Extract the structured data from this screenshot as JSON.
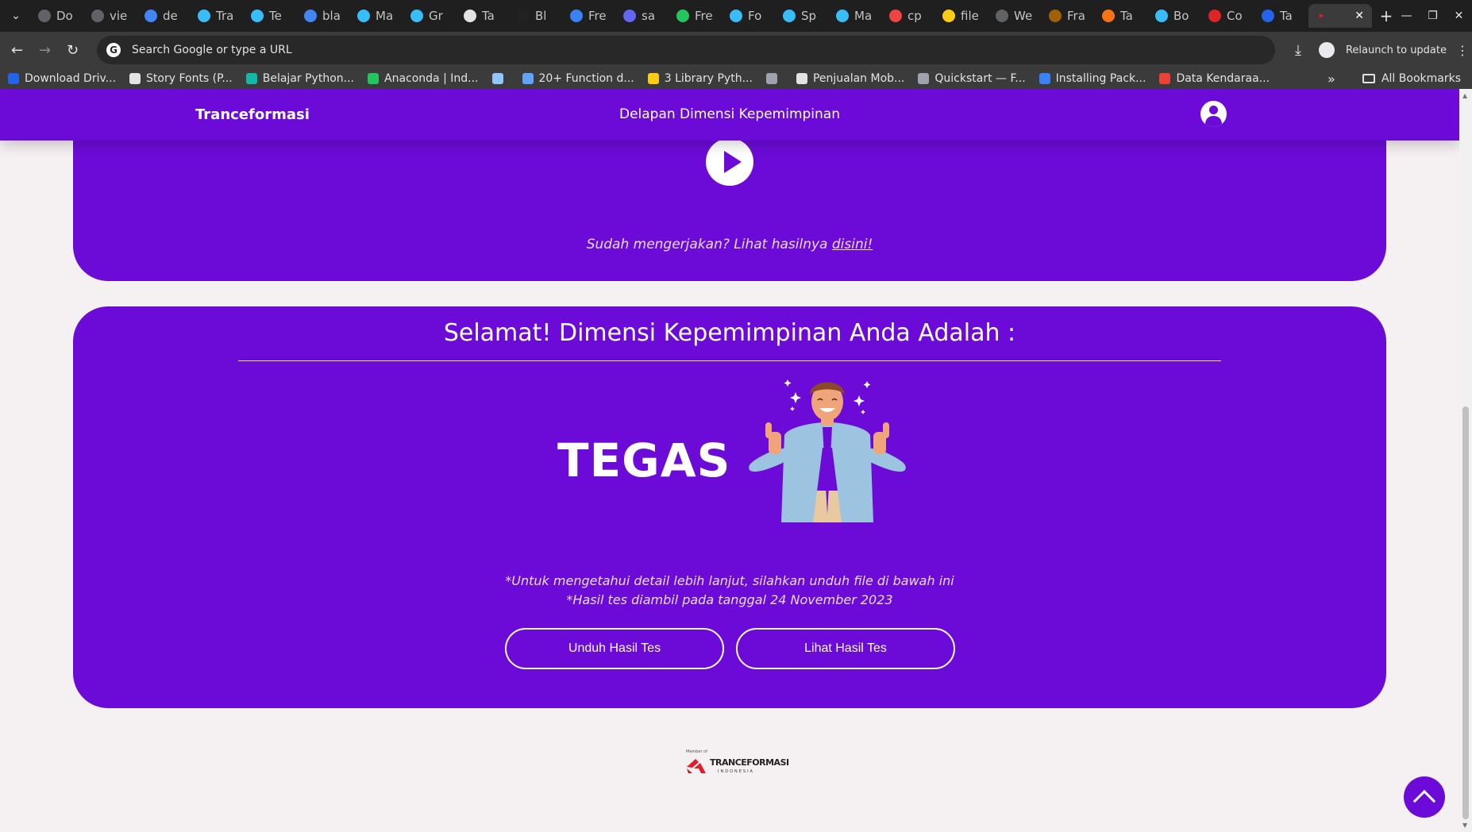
{
  "browser": {
    "tabs": [
      {
        "label": "Do",
        "fav_color": "#5f6368"
      },
      {
        "label": "vie",
        "fav_color": "#5f6368"
      },
      {
        "label": "de",
        "fav_color": "#4285f4"
      },
      {
        "label": "Tra",
        "fav_color": "#38bdf8"
      },
      {
        "label": "Te",
        "fav_color": "#38bdf8"
      },
      {
        "label": "bla",
        "fav_color": "#4285f4"
      },
      {
        "label": "Ma",
        "fav_color": "#38bdf8"
      },
      {
        "label": "Gr",
        "fav_color": "#38bdf8"
      },
      {
        "label": "Ta",
        "fav_color": "#e3e3e3"
      },
      {
        "label": "Bl",
        "fav_color": "#222222"
      },
      {
        "label": "Fre",
        "fav_color": "#3b82f6"
      },
      {
        "label": "sa",
        "fav_color": "#6366f1"
      },
      {
        "label": "Fre",
        "fav_color": "#22c55e"
      },
      {
        "label": "Fo",
        "fav_color": "#38bdf8"
      },
      {
        "label": "Sp",
        "fav_color": "#38bdf8"
      },
      {
        "label": "Ma",
        "fav_color": "#38bdf8"
      },
      {
        "label": "cp",
        "fav_color": "#ef4444"
      },
      {
        "label": "file",
        "fav_color": "#facc15"
      },
      {
        "label": "We",
        "fav_color": "#5f6368"
      },
      {
        "label": "Fra",
        "fav_color": "#a16207"
      },
      {
        "label": "Ta",
        "fav_color": "#f97316"
      },
      {
        "label": "Bo",
        "fav_color": "#38bdf8"
      },
      {
        "label": "Co",
        "fav_color": "#dc2626"
      },
      {
        "label": "Ta",
        "fav_color": "#2563eb"
      }
    ],
    "omnibox_placeholder": "Search Google or type a URL",
    "relaunch_label": "Relaunch to update",
    "bookmarks": [
      {
        "label": "Download Driv...",
        "fav_color": "#2563eb"
      },
      {
        "label": "Story Fonts (P...",
        "fav_color": "#e3e3e3"
      },
      {
        "label": "Belajar Python...",
        "fav_color": "#14b8a6"
      },
      {
        "label": "Anaconda | Ind...",
        "fav_color": "#22c55e"
      },
      {
        "label": "",
        "fav_color": "#93c5fd"
      },
      {
        "label": "20+ Function d...",
        "fav_color": "#60a5fa"
      },
      {
        "label": "3 Library Pyth...",
        "fav_color": "#facc15"
      },
      {
        "label": "",
        "fav_color": "#9ca3af"
      },
      {
        "label": "Penjualan Mob...",
        "fav_color": "#e3e3e3"
      },
      {
        "label": "Quickstart — F...",
        "fav_color": "#9ca3af"
      },
      {
        "label": "Installing Pack...",
        "fav_color": "#3b82f6"
      },
      {
        "label": "Data Kendaraa...",
        "fav_color": "#ea4335"
      }
    ],
    "all_bookmarks_label": "All Bookmarks"
  },
  "site": {
    "brand": "Tranceformasi",
    "nav_title": "Delapan Dimensi Kepemimpinan",
    "done_text": "Sudah mengerjakan? Lihat hasilnya ",
    "done_link": "disini!",
    "result_title": "Selamat! Dimensi Kepemimpinan Anda Adalah :",
    "result_word": "TEGAS",
    "note_detail": "*Untuk mengetahui detail lebih lanjut, silahkan unduh file di bawah ini",
    "note_date": "*Hasil tes diambil pada tanggal 24 November 2023",
    "btn_download": "Unduh Hasil Tes",
    "btn_view": "Lihat Hasil Tes",
    "footer_member_of": "Member of",
    "footer_logo_word": "TRANCEFORMASI",
    "footer_logo_sub": "INDONESIA"
  },
  "colors": {
    "accent": "#6c0bd8",
    "page_bg": "#f5f0f1"
  }
}
